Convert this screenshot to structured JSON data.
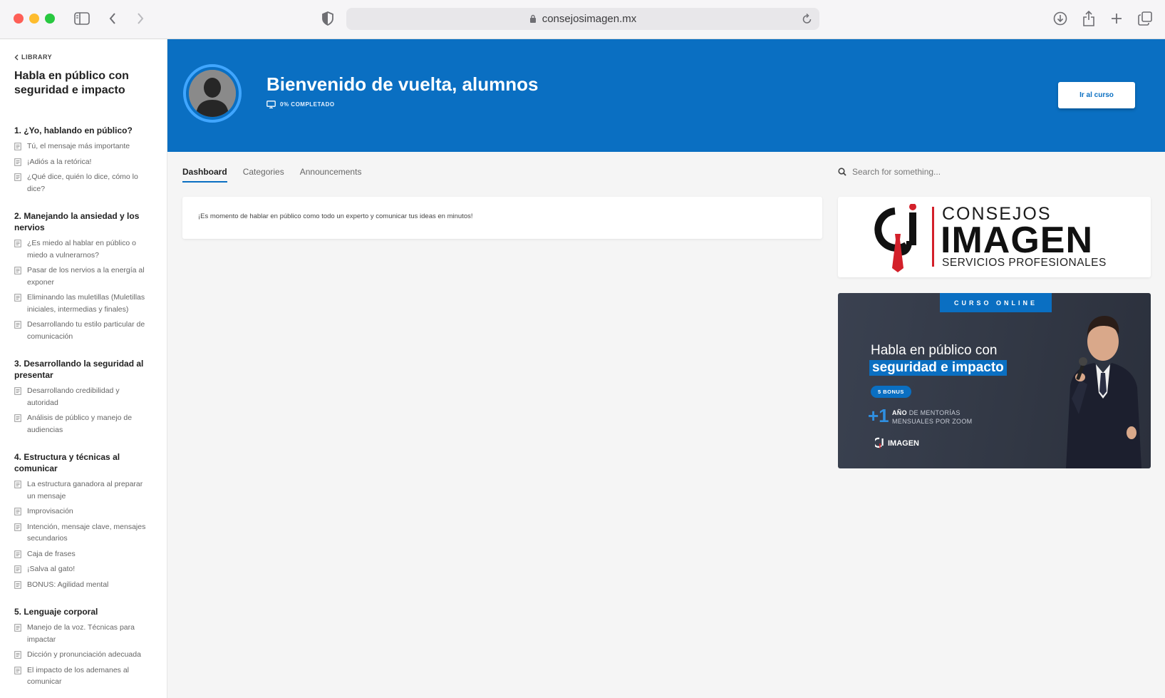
{
  "browser": {
    "url": "consejosimagen.mx"
  },
  "sidebar": {
    "back_label": "LIBRARY",
    "course_title": "Habla en público con seguridad e impacto",
    "sections": [
      {
        "title": "1. ¿Yo, hablando en público?",
        "lessons": [
          "Tú, el mensaje más importante",
          "¡Adiós a la retórica!",
          "¿Qué dice, quién lo dice, cómo lo dice?"
        ]
      },
      {
        "title": "2. Manejando la ansiedad y los nervios",
        "lessons": [
          "¿Es miedo al hablar en público o miedo a vulnerarnos?",
          "Pasar de los nervios a la energía al exponer",
          "Eliminando las muletillas (Muletillas iniciales, intermedias y finales)",
          "Desarrollando tu estilo particular de comunicación"
        ]
      },
      {
        "title": "3. Desarrollando la seguridad al presentar",
        "lessons": [
          "Desarrollando credibilidad y autoridad",
          "Análisis de público y manejo de audiencias"
        ]
      },
      {
        "title": "4. Estructura y técnicas al comunicar",
        "lessons": [
          "La estructura ganadora al preparar un mensaje",
          "Improvisación",
          "Intención, mensaje clave, mensajes secundarios",
          "Caja de frases",
          "¡Salva al gato!",
          "BONUS: Agilidad mental"
        ]
      },
      {
        "title": "5. Lenguaje corporal",
        "lessons": [
          "Manejo de la voz. Técnicas para impactar",
          "Dicción y pronunciación adecuada",
          "El impacto de los ademanes al comunicar"
        ]
      }
    ]
  },
  "banner": {
    "welcome": "Bienvenido de vuelta, alumnos",
    "progress": "0% COMPLETADO",
    "button_label": "Ir al curso",
    "color": "#0a6fc2"
  },
  "tabs": [
    "Dashboard",
    "Categories",
    "Announcements"
  ],
  "search": {
    "placeholder": "Search for something..."
  },
  "announcement": "¡Es momento de hablar en público como todo un experto y comunicar tus ideas en minutos!",
  "logo": {
    "top": "CONSEJOS",
    "main": "IMAGEN",
    "sub": "SERVICIOS PROFESIONALES"
  },
  "promo": {
    "tag": "CURSO ONLINE",
    "title_line1": "Habla en público con",
    "title_line2": "seguridad e impacto",
    "badge": "5 BONUS",
    "plus": "+1",
    "mentor_bold": "AÑO",
    "mentor_rest": " DE MENTORÍAS",
    "mentor_line2": "MENSUALES POR ZOOM",
    "logo_text": "IMAGEN"
  }
}
